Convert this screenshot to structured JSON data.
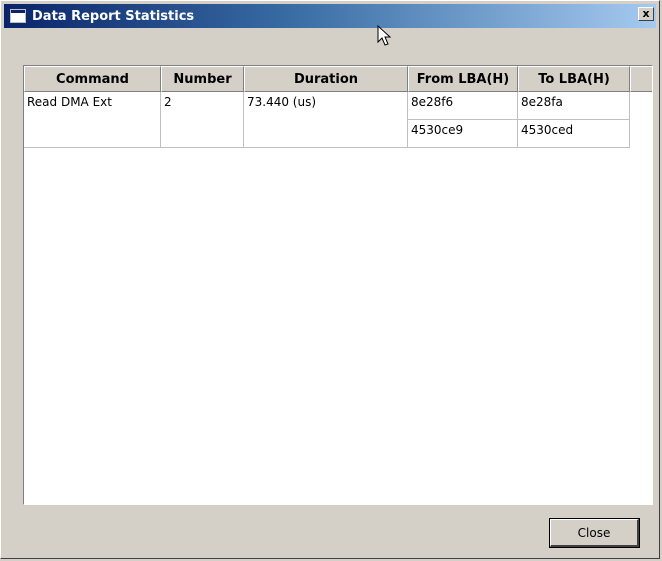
{
  "window": {
    "title": "Data Report Statistics",
    "close_glyph": "x"
  },
  "table": {
    "columns": [
      "Command",
      "Number",
      "Duration",
      "From LBA(H)",
      "To LBA(H)"
    ],
    "rows": [
      {
        "command": "Read DMA Ext",
        "number": "2",
        "duration": "73.440 (us)",
        "from_lba": [
          "8e28f6",
          "4530ce9"
        ],
        "to_lba": [
          "8e28fa",
          "4530ced"
        ]
      }
    ]
  },
  "buttons": {
    "close_label": "Close"
  },
  "colors": {
    "title_gradient_start": "#0a246a",
    "title_gradient_end": "#a6caf0",
    "face": "#d4d0c8"
  }
}
